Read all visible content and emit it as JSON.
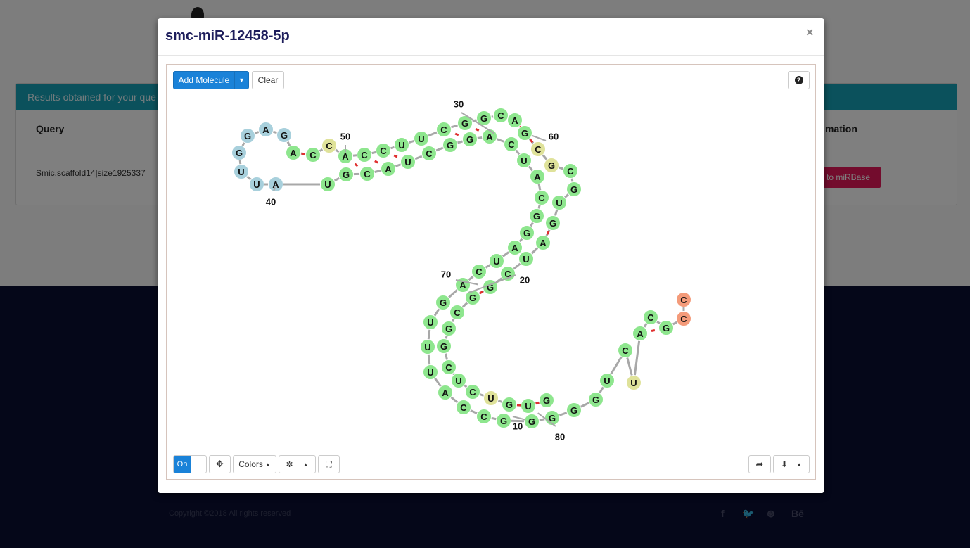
{
  "background": {
    "results_header": "Results obtained for your que",
    "query_header": "Query",
    "info_header": "mation",
    "query_value": "Smic.scaffold14|size1925337",
    "mirbase_button": "to miRBase",
    "copyright": "Copyright ©2018 All rights reserved",
    "social_icons": [
      "facebook-icon",
      "twitter-icon",
      "dribbble-icon",
      "behance-icon"
    ],
    "social_glyphs": [
      "f",
      "🐦",
      "⊛",
      "Bē"
    ]
  },
  "modal": {
    "title": "smc-miR-12458-5p",
    "close": "×"
  },
  "toolbar": {
    "add_molecule": "Add Molecule",
    "clear": "Clear",
    "help": "?",
    "toggle_on": "On",
    "colors": "Colors",
    "move_icon": "✥",
    "settings_icon": "✲",
    "fullscreen_icon": "⛶",
    "share_icon": "➦",
    "download_icon": "⬇"
  },
  "colors": {
    "stem": "#8ee68e",
    "hairpin_loop": "#a8d0dc",
    "interior_loop": "#dfe29a",
    "dangling": "#f49b7a",
    "backbone": "#a8a8a8",
    "pair_bond": "#e03030"
  },
  "structure": {
    "nucleotides": [
      {
        "b": "C",
        "c": "dangling"
      },
      {
        "b": "C",
        "c": "dangling"
      },
      {
        "b": "G",
        "c": "stem"
      },
      {
        "b": "C",
        "c": "stem"
      },
      {
        "b": "A",
        "c": "stem"
      },
      {
        "b": "U",
        "c": "interior_loop"
      },
      {
        "b": "C",
        "c": "stem"
      },
      {
        "b": "U",
        "c": "stem"
      },
      {
        "b": "G",
        "c": "stem"
      },
      {
        "b": "G",
        "c": "stem"
      },
      {
        "b": "G",
        "c": "stem"
      },
      {
        "b": "G",
        "c": "stem"
      },
      {
        "b": "G",
        "c": "stem"
      },
      {
        "b": "C",
        "c": "stem"
      },
      {
        "b": "C",
        "c": "stem"
      },
      {
        "b": "A",
        "c": "stem"
      },
      {
        "b": "U",
        "c": "stem"
      },
      {
        "b": "U",
        "c": "stem"
      },
      {
        "b": "U",
        "c": "stem"
      },
      {
        "b": "G",
        "c": "stem"
      },
      {
        "b": "A",
        "c": "stem"
      },
      {
        "b": "C",
        "c": "stem"
      },
      {
        "b": "U",
        "c": "stem"
      },
      {
        "b": "A",
        "c": "stem"
      },
      {
        "b": "G",
        "c": "stem"
      },
      {
        "b": "G",
        "c": "stem"
      },
      {
        "b": "C",
        "c": "stem"
      },
      {
        "b": "A",
        "c": "stem"
      },
      {
        "b": "U",
        "c": "stem"
      },
      {
        "b": "C",
        "c": "stem"
      },
      {
        "b": "A",
        "c": "stem"
      },
      {
        "b": "G",
        "c": "stem"
      },
      {
        "b": "G",
        "c": "stem"
      },
      {
        "b": "C",
        "c": "stem"
      },
      {
        "b": "U",
        "c": "stem"
      },
      {
        "b": "A",
        "c": "stem"
      },
      {
        "b": "C",
        "c": "stem"
      },
      {
        "b": "G",
        "c": "stem"
      },
      {
        "b": "U",
        "c": "stem"
      },
      {
        "b": "A",
        "c": "hairpin_loop"
      },
      {
        "b": "U",
        "c": "hairpin_loop"
      },
      {
        "b": "U",
        "c": "hairpin_loop"
      },
      {
        "b": "G",
        "c": "hairpin_loop"
      },
      {
        "b": "G",
        "c": "hairpin_loop"
      },
      {
        "b": "A",
        "c": "hairpin_loop"
      },
      {
        "b": "G",
        "c": "hairpin_loop"
      },
      {
        "b": "A",
        "c": "stem"
      },
      {
        "b": "C",
        "c": "stem"
      },
      {
        "b": "C",
        "c": "interior_loop"
      },
      {
        "b": "A",
        "c": "stem"
      },
      {
        "b": "C",
        "c": "stem"
      },
      {
        "b": "C",
        "c": "stem"
      },
      {
        "b": "U",
        "c": "stem"
      },
      {
        "b": "U",
        "c": "stem"
      },
      {
        "b": "C",
        "c": "stem"
      },
      {
        "b": "G",
        "c": "stem"
      },
      {
        "b": "G",
        "c": "stem"
      },
      {
        "b": "C",
        "c": "stem"
      },
      {
        "b": "A",
        "c": "stem"
      },
      {
        "b": "G",
        "c": "stem"
      },
      {
        "b": "C",
        "c": "interior_loop"
      },
      {
        "b": "G",
        "c": "interior_loop"
      },
      {
        "b": "C",
        "c": "stem"
      },
      {
        "b": "G",
        "c": "stem"
      },
      {
        "b": "U",
        "c": "stem"
      },
      {
        "b": "G",
        "c": "stem"
      },
      {
        "b": "A",
        "c": "stem"
      },
      {
        "b": "U",
        "c": "stem"
      },
      {
        "b": "C",
        "c": "stem"
      },
      {
        "b": "G",
        "c": "stem"
      },
      {
        "b": "G",
        "c": "stem"
      },
      {
        "b": "C",
        "c": "stem"
      },
      {
        "b": "G",
        "c": "stem"
      },
      {
        "b": "G",
        "c": "stem"
      },
      {
        "b": "C",
        "c": "stem"
      },
      {
        "b": "U",
        "c": "stem"
      },
      {
        "b": "C",
        "c": "stem"
      },
      {
        "b": "U",
        "c": "interior_loop"
      },
      {
        "b": "G",
        "c": "stem"
      },
      {
        "b": "U",
        "c": "stem"
      },
      {
        "b": "G",
        "c": "stem"
      }
    ],
    "position_labels": [
      "10",
      "20",
      "30",
      "40",
      "50",
      "60",
      "70",
      "80"
    ]
  }
}
